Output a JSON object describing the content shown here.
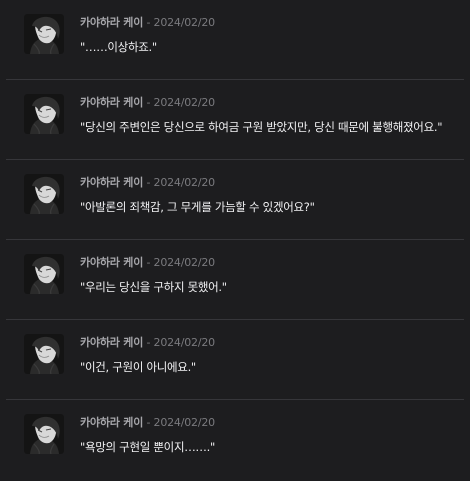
{
  "entries": [
    {
      "author": "카야하라 케이",
      "separator": "-",
      "date": "2024/02/20",
      "text": "\"……이상하죠.\""
    },
    {
      "author": "카야하라 케이",
      "separator": "-",
      "date": "2024/02/20",
      "text": "\"당신의 주변인은 당신으로 하여금 구원 받았지만, 당신 때문에 불행해졌어요.\""
    },
    {
      "author": "카야하라 케이",
      "separator": "-",
      "date": "2024/02/20",
      "text": "\"아발론의 죄책감, 그 무게를 가늠할 수 있겠어요?\""
    },
    {
      "author": "카야하라 케이",
      "separator": "-",
      "date": "2024/02/20",
      "text": "\"우리는 당신을 구하지 못했어.\""
    },
    {
      "author": "카야하라 케이",
      "separator": "-",
      "date": "2024/02/20",
      "text": "\"이건, 구원이 아니에요.\""
    },
    {
      "author": "카야하라 케이",
      "separator": "-",
      "date": "2024/02/20",
      "text": "\"욕망의 구현일 뿐이지…….\""
    }
  ]
}
